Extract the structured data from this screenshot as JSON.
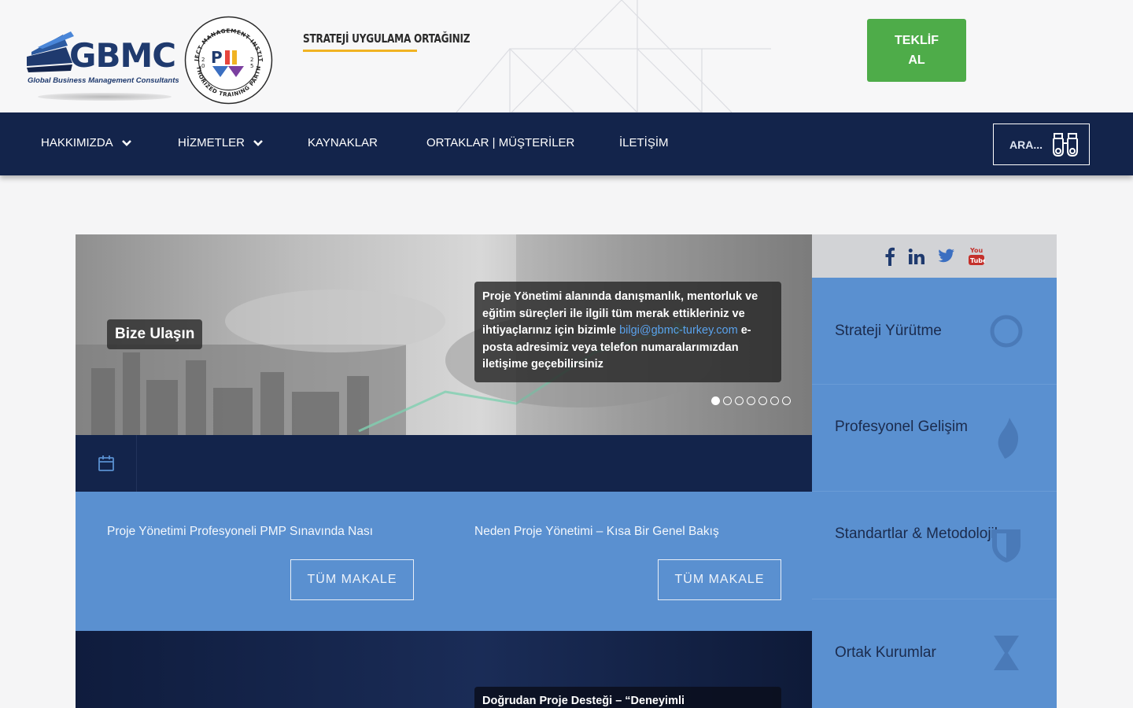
{
  "header": {
    "logo_text": "GBMC",
    "logo_subtitle": "Global Business Management Consultants",
    "badge_top": "PROJECT MANAGEMENT INSTITUTE",
    "badge_bottom": "AUTHORIZED TRAINING PARTNER",
    "tagline": "STRATEJİ UYGULAMA ORTAĞINIZ",
    "cta_line1": "TEKLİF",
    "cta_line2": "AL"
  },
  "nav": {
    "items": [
      {
        "label": "HAKKIMIZDA",
        "has_dropdown": true
      },
      {
        "label": "HİZMETLER",
        "has_dropdown": true
      },
      {
        "label": "KAYNAKLAR",
        "has_dropdown": false
      },
      {
        "label": "ORTAKLAR | MÜŞTERİLER",
        "has_dropdown": false
      },
      {
        "label": "İLETİŞİM",
        "has_dropdown": false
      }
    ],
    "search_label": "ARA..."
  },
  "hero": {
    "label": "Bize Ulaşın",
    "caption_before": "Proje Yönetimi alanında danışmanlık, mentorluk ve eğitim süreçleri ile ilgili tüm merak ettikleriniz ve ihtiyaçlarınız için bizimle ",
    "caption_email": "bilgi@gbmc-turkey.com",
    "caption_after": " e-posta adresimiz veya telefon numaralarımızdan iletişime geçebilirsiniz",
    "slide_count": 7,
    "active_slide": 1
  },
  "articles": [
    {
      "title": "Proje Yönetimi Profesyoneli PMP Sınavında Nası",
      "button": "TÜM MAKALE"
    },
    {
      "title": "Neden Proje Yönetimi – Kısa Bir Genel Bakış",
      "button": "TÜM MAKALE"
    }
  ],
  "bottom_hero": {
    "caption": "Doğrudan Proje Desteği – “Deneyimli"
  },
  "social": [
    "facebook-icon",
    "linkedin-icon",
    "twitter-icon",
    "youtube-icon"
  ],
  "sidebar": {
    "items": [
      {
        "label": "Strateji Yürütme",
        "icon": "ring-icon"
      },
      {
        "label": "Profesyonel Gelişim",
        "icon": "flame-icon"
      },
      {
        "label": "Standartlar & Metodolojiler",
        "icon": "shield-icon"
      },
      {
        "label": "Ortak Kurumlar",
        "icon": "hourglass-icon"
      }
    ]
  },
  "colors": {
    "nav_bg": "#13244b",
    "accent_blue": "#5a90d0",
    "cta_green": "#4eac49",
    "tagline_underline": "#f0b323"
  }
}
